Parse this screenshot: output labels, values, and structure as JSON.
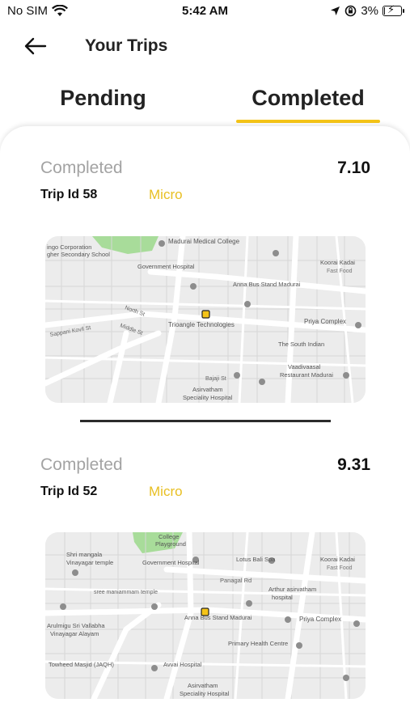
{
  "status_bar": {
    "carrier": "No SIM",
    "time": "5:42 AM",
    "battery": "3%",
    "battery_level": 0.03
  },
  "header": {
    "title": "Your Trips",
    "back_icon": "arrow-left-icon"
  },
  "tabs": [
    {
      "label": "Pending",
      "active": false
    },
    {
      "label": "Completed",
      "active": true
    }
  ],
  "accent_color": "#f5c418",
  "trips": [
    {
      "status": "Completed",
      "fare": "7.10",
      "trip_id": "Trip Id 58",
      "vehicle_type": "Micro",
      "map_labels": {
        "poi_1": "Madurai Medical College",
        "poi_2": "Government Hospital",
        "poi_3": "Anna Bus Stand Madurai",
        "poi_4": "Koorai Kadai",
        "poi_5": "Fast Food",
        "poi_6": "Trioangle Technologies",
        "poi_7": "Priya Complex",
        "poi_8": "The South Indian",
        "poi_9": "Vaadivaasal",
        "poi_10": "Restaurant Madurai",
        "poi_11": "Asirvatham",
        "poi_12": "Speciality Hospital",
        "poi_13": "ingo Corporation",
        "poi_14": "gher Secondary School",
        "road_1": "North St",
        "road_2": "Middle St",
        "road_3": "Bajaji St",
        "road_4": "Sappani Kovil St"
      }
    },
    {
      "status": "Completed",
      "fare": "9.31",
      "trip_id": "Trip Id 52",
      "vehicle_type": "Micro",
      "map_labels": {
        "poi_1": "College",
        "poi_2": "Playground",
        "poi_3": "Government Hospital",
        "poi_4": "Lotus Bali Spa",
        "poi_5": "Koorai Kadai",
        "poi_6": "Fast Food",
        "poi_7": "Shri mangala",
        "poi_8": "Vinayagar temple",
        "poi_9": "Arthur asirvatham",
        "poi_10": "hospital",
        "poi_11": "Anna Bus Stand Madurai",
        "poi_12": "Priya Complex",
        "poi_13": "Arulmigu Sri Vallabha",
        "poi_14": "Vinayagar Alayam",
        "poi_15": "Primary Health Centre",
        "poi_16": "Towheed Masjid (JAQH)",
        "poi_17": "Avvai Hospital",
        "poi_18": "Asirvatham",
        "poi_19": "Speciality Hospital",
        "road_1": "Panagal Rd",
        "road_2": "sree maniammam temple"
      }
    }
  ]
}
